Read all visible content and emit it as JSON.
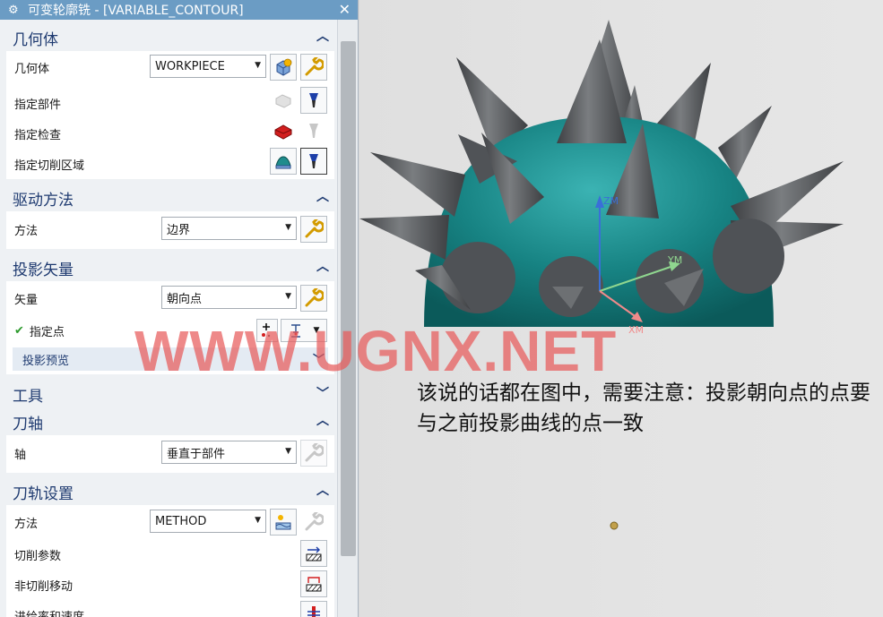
{
  "dialog": {
    "title": "可变轮廓铣 - [VARIABLE_CONTOUR]",
    "sections": {
      "geometry": {
        "header": "几何体",
        "geometry_label": "几何体",
        "geometry_value": "WORKPIECE",
        "part_label": "指定部件",
        "check_label": "指定检查",
        "cut_area_label": "指定切削区域"
      },
      "drive": {
        "header": "驱动方法",
        "method_label": "方法",
        "method_value": "边界"
      },
      "projection": {
        "header": "投影矢量",
        "vector_label": "矢量",
        "vector_value": "朝向点",
        "point_label": "指定点",
        "preview_label": "投影预览"
      },
      "tool": {
        "header": "工具"
      },
      "tool_axis": {
        "header": "刀轴",
        "axis_label": "轴",
        "axis_value": "垂直于部件"
      },
      "path_settings": {
        "header": "刀轨设置",
        "method_label": "方法",
        "method_value": "METHOD",
        "cut_params_label": "切削参数",
        "non_cut_label": "非切削移动",
        "feeds_label": "进给率和速度"
      }
    }
  },
  "viewport": {
    "axis_zm": "ZM",
    "axis_ym": "YM",
    "axis_xm": "XM",
    "watermark": "WWW.UGNX.NET",
    "note": "该说的话都在图中，需要注意：投影朝向点的点要与之前投影曲线的点一致"
  },
  "colors": {
    "title_bar": "#6b9cc4",
    "section_header_text": "#1e3a70",
    "dome": "#1f8c8c",
    "spike": "#5a5c5f",
    "watermark": "#e85c5c"
  }
}
